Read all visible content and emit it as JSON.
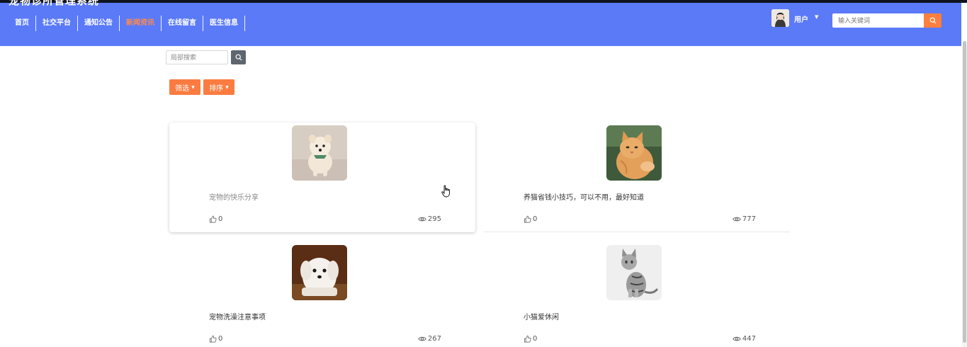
{
  "header": {
    "site_title": "宠物诊所管理系统",
    "nav": [
      "首页",
      "社交平台",
      "通知公告",
      "新闻资讯",
      "在线留言",
      "医生信息"
    ],
    "active_nav": "新闻资讯",
    "user_label": "用户",
    "search_placeholder": "输入关键词",
    "accent_color": "#ff7f3f",
    "bar_color": "#5b7af8"
  },
  "toolbar": {
    "local_search_placeholder": "局部搜索",
    "filter_label": "筛选",
    "sort_label": "排序"
  },
  "articles": [
    {
      "title": "宠物的快乐分享",
      "likes": "0",
      "views": "295",
      "image": "pomeranian-photo"
    },
    {
      "title": "养猫省钱小技巧，可以不用，最好知道",
      "likes": "0",
      "views": "777",
      "image": "orange-cat-photo"
    },
    {
      "title": "宠物洗澡注意事项",
      "likes": "0",
      "views": "267",
      "image": "white-puppy-photo"
    },
    {
      "title": "小猫爱休闲",
      "likes": "0",
      "views": "447",
      "image": "tabby-cat-photo"
    }
  ]
}
